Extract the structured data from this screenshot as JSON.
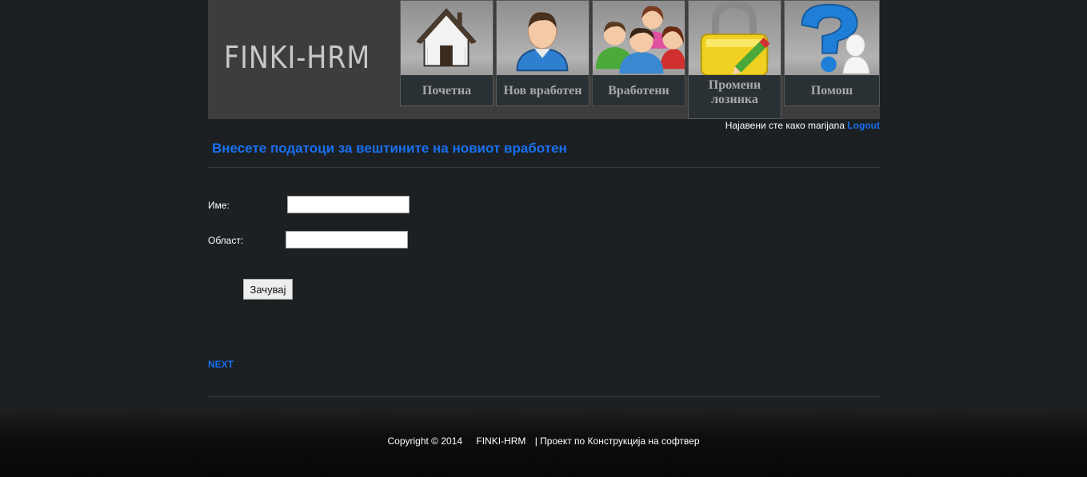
{
  "header": {
    "logo": "FINKI-HRM",
    "nav": [
      {
        "label": "Почетна",
        "icon": "house-icon"
      },
      {
        "label": "Нов вработен",
        "icon": "new-employee-icon"
      },
      {
        "label": "Вработени",
        "icon": "employees-group-icon"
      },
      {
        "label": "Промени лозинка",
        "icon": "lock-edit-icon"
      },
      {
        "label": "Помош",
        "icon": "help-question-icon"
      }
    ]
  },
  "user": {
    "logged_in_text": "Најавени сте како marijana",
    "logout_label": "Logout"
  },
  "main": {
    "title": "Внесете податоци за вештините на новиот вработен",
    "fields": {
      "name_label": "Име:",
      "name_value": "",
      "area_label": "Област:",
      "area_value": ""
    },
    "save_label": "Зачувај",
    "next_label": "NEXT"
  },
  "footer": {
    "copyright": "Copyright © 2014",
    "app": "FINKI-HRM",
    "project": "| Проект по Конструкција на софтвер"
  },
  "colors": {
    "accent": "#1a6ff0",
    "background": "#1c2022",
    "banner": "#3d3d3d",
    "nav_label_bg": "#2a3134"
  }
}
